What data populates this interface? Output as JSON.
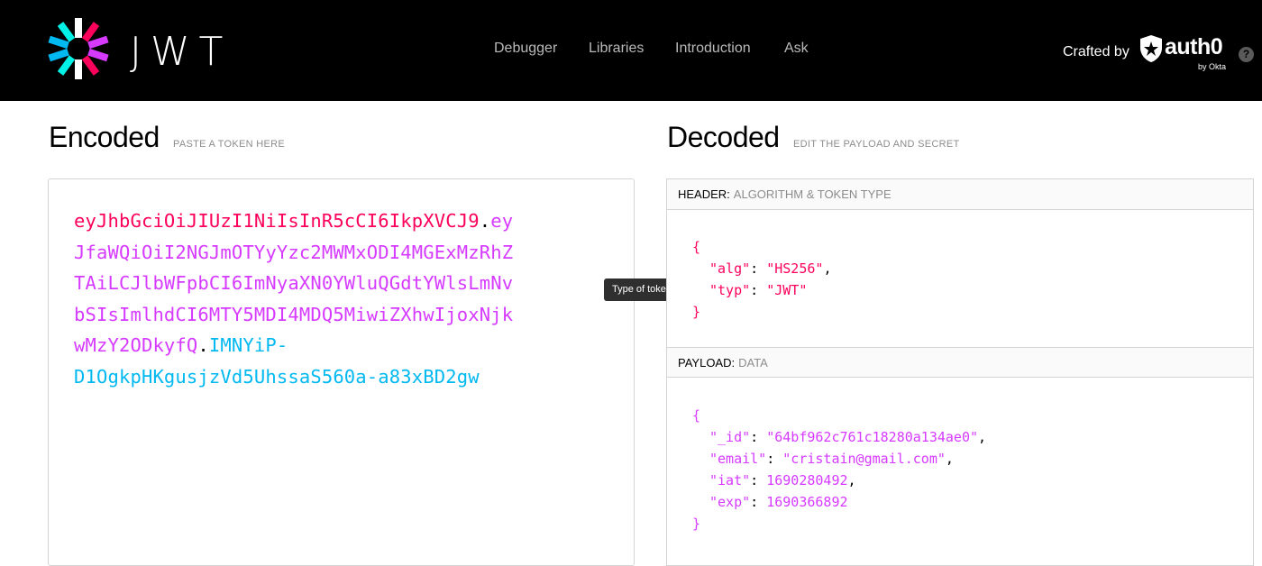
{
  "nav": {
    "brand": "JWT",
    "links": [
      "Debugger",
      "Libraries",
      "Introduction",
      "Ask"
    ],
    "crafted_by": "Crafted by",
    "partner": "auth0",
    "partner_sub": "by Okta",
    "help": "?"
  },
  "encoded": {
    "title": "Encoded",
    "subtitle": "PASTE A TOKEN HERE",
    "lines": [
      [
        {
          "t": "eyJhbGciOiJIUzI1NiIsInR5cCI6IkpXVCJ9",
          "c": "red"
        },
        {
          "t": ".",
          "c": "dot"
        },
        {
          "t": "ey",
          "c": "purple"
        }
      ],
      [
        {
          "t": "JfaWQiOiI2NGJmOTYyYzc2MWMxODI4MGExMzRhZ",
          "c": "purple"
        }
      ],
      [
        {
          "t": "TAiLCJlbWFpbCI6ImNyaXN0YWluQGdtYWlsLmNv",
          "c": "purple"
        }
      ],
      [
        {
          "t": "bSIsImlhdCI6MTY5MDI4MDQ5MiwiZXhwIjoxNjk",
          "c": "purple"
        }
      ],
      [
        {
          "t": "wMzY2ODkyfQ",
          "c": "purple"
        },
        {
          "t": ".",
          "c": "dot"
        },
        {
          "t": "IMNYiP-",
          "c": "cyan"
        }
      ],
      [
        {
          "t": "D1OgkpHKgusjzVd5UhssaS560a-a83xBD2gw",
          "c": "cyan"
        }
      ]
    ]
  },
  "tooltip": "Type of token",
  "decoded": {
    "title": "Decoded",
    "subtitle": "EDIT THE PAYLOAD AND SECRET",
    "header_panel": {
      "label": "HEADER:",
      "description": "ALGORITHM & TOKEN TYPE",
      "open": "{",
      "close": "}",
      "entries": [
        {
          "key": "\"alg\"",
          "value": "\"HS256\"",
          "comma": true
        },
        {
          "key": "\"typ\"",
          "value": "\"JWT\"",
          "comma": false
        }
      ]
    },
    "payload_panel": {
      "label": "PAYLOAD:",
      "description": "DATA",
      "open": "{",
      "close": "}",
      "entries": [
        {
          "key": "\"_id\"",
          "value": "\"64bf962c761c18280a134ae0\"",
          "comma": true
        },
        {
          "key": "\"email\"",
          "value": "\"cristain@gmail.com\"",
          "comma": true
        },
        {
          "key": "\"iat\"",
          "value": "1690280492",
          "comma": true
        },
        {
          "key": "\"exp\"",
          "value": "1690366892",
          "comma": false
        }
      ]
    }
  },
  "colors": {
    "header_red": "#fb015b",
    "payload_purple": "#d63aff",
    "signature_cyan": "#00b9f1"
  }
}
